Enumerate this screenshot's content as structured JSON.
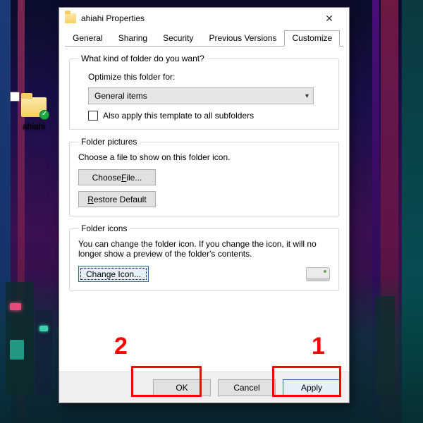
{
  "desktop": {
    "icon_label": "ahiahi"
  },
  "annotations": {
    "one": "1",
    "two": "2"
  },
  "window": {
    "title": "ahiahi Properties",
    "close_glyph": "✕",
    "tabs": {
      "general": "General",
      "sharing": "Sharing",
      "security": "Security",
      "previous_versions": "Previous Versions",
      "customize": "Customize"
    },
    "section_kind": {
      "legend": "What kind of folder do you want?",
      "optimize_label": "Optimize this folder for:",
      "combo_value": "General items",
      "also_apply": "Also apply this template to all subfolders"
    },
    "section_pictures": {
      "legend": "Folder pictures",
      "choose_hint": "Choose a file to show on this folder icon.",
      "choose_file_btn_pre": "Choose ",
      "choose_file_btn_u": "F",
      "choose_file_btn_post": "ile...",
      "restore_btn_u": "R",
      "restore_btn_post": "estore Default"
    },
    "section_icons": {
      "legend": "Folder icons",
      "desc": "You can change the folder icon. If you change the icon, it will no longer show a preview of the folder's contents.",
      "change_icon_btn": "Change Icon..."
    },
    "footer": {
      "ok": "OK",
      "cancel": "Cancel",
      "apply": "Apply"
    }
  }
}
